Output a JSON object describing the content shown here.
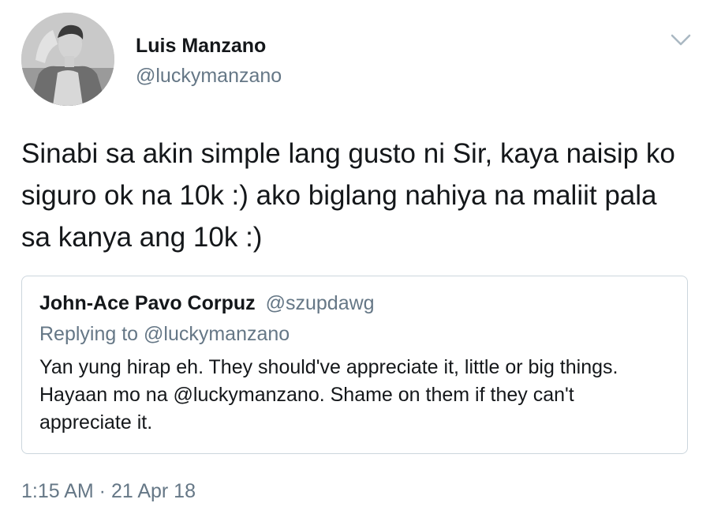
{
  "tweet": {
    "author_name": "Luis Manzano",
    "author_handle": "@luckymanzano",
    "text": "Sinabi sa akin simple lang gusto ni Sir, kaya naisip ko siguro ok na 10k :) ako biglang nahiya na maliit pala sa kanya ang 10k :)",
    "timestamp": "1:15 AM · 21 Apr 18",
    "menu_icon": "chevron-down-icon"
  },
  "quoted_tweet": {
    "author_name": "John-Ace Pavo Corpuz",
    "author_handle": "@szupdawg",
    "replying_to": "Replying to @luckymanzano",
    "text": "Yan yung hirap eh. They should've appreciate it, little or big things. Hayaan mo na @luckymanzano. Shame on them if they can't appreciate it."
  },
  "colors": {
    "primary_text": "#14171a",
    "secondary_text": "#657786",
    "border": "#ccd6dd"
  }
}
